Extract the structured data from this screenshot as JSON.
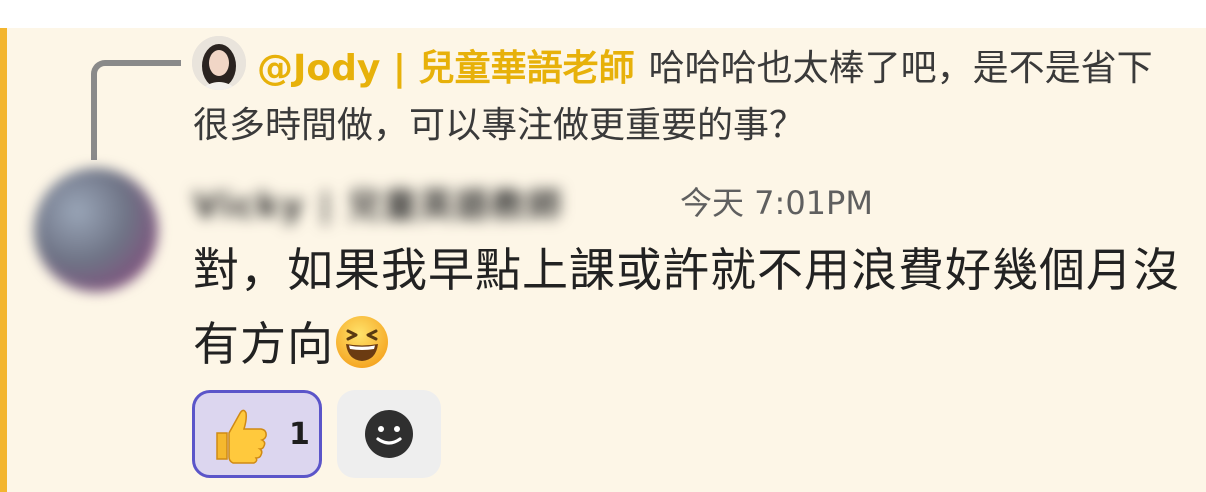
{
  "reply": {
    "author": "@Jody | 兒童華語老師",
    "text": "哈哈哈也太棒了吧，是不是省下很多時間做，可以專注做更重要的事？",
    "avatar_icon": "profile-photo"
  },
  "message": {
    "author": "Vicky | 兒童英語教師",
    "timestamp": "今天 7:01PM",
    "text": "對，如果我早點上課或許就不用浪費好幾個月沒有方向",
    "emoji": "laughing-squint-emoji"
  },
  "reactions": [
    {
      "emoji": "thumbs-up",
      "count": "1",
      "selected": true
    }
  ],
  "add_reaction_icon": "smiley-add-reaction-icon",
  "colors": {
    "highlight": "#f3b52e",
    "background": "#fdf6e7",
    "reply_author": "#e7b10a",
    "reaction_border": "#5b55c9",
    "reaction_bg": "#dcd6ef"
  }
}
